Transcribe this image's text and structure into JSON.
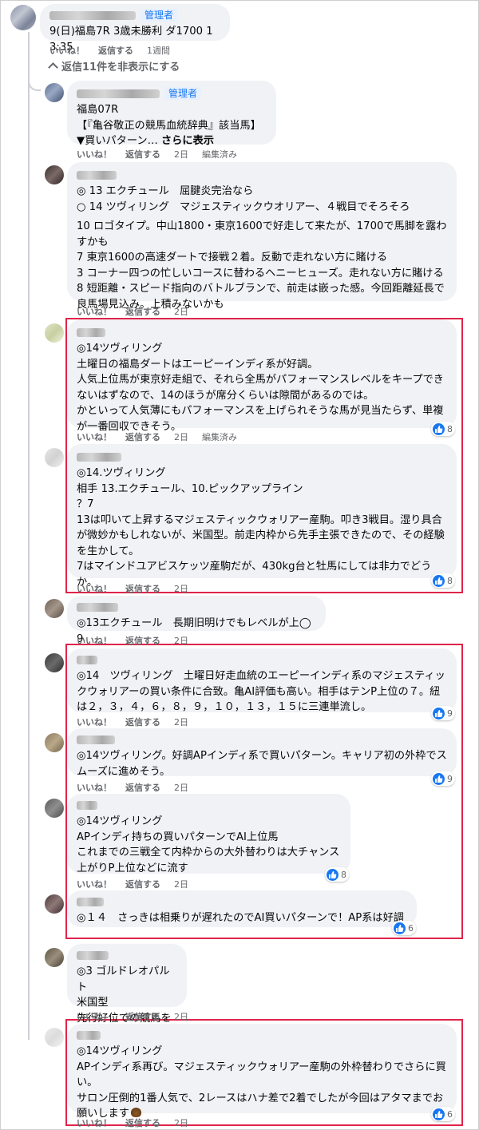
{
  "ui": {
    "admin_label": "管理者",
    "like_label": "いいね！",
    "reply_label": "返信する",
    "edited_label": "編集済み",
    "hide_replies_label": "返信11件を非表示にする"
  },
  "colors": {
    "accent": "#1877f2",
    "highlight_box": "#e0244a",
    "bubble_bg": "#f0f2f5",
    "meta_text": "#65676b"
  },
  "comments": [
    {
      "text": "9(日)福島7R 3歳未勝利 ダ1700 13:35",
      "time": "1週間"
    },
    {
      "text": "福島07R\n【『亀谷敬正の競馬血統辞典』該当馬】\n▼買いパターン… ",
      "see_more": "さらに表示",
      "time": "2日",
      "edited": true
    },
    {
      "text": "◎ 13 エクチュール　屈腱炎完治なら\n○ 14 ツヴィリング　マジェスティックウオリアー、４戦目でそろそろ",
      "text2": "10 ロゴタイプ。中山1800・東京1600で好走して来たが、1700で馬脚を露わすかも\n7 東京1600の高速ダートで接戦２着。反動で走れない方に賭ける\n3 コーナー四つの忙しいコースに替わるヘニーヒューズ。走れない方に賭ける\n8 短距離・スピード指向のバトルブランで、前走は嵌った感。今回距離延長で良馬場見込み。上積みないかも",
      "time": "2日"
    },
    {
      "text": "◎14ツヴィリング\n土曜日の福島ダートはエーピーインディ系が好調。\n人気上位馬が東京好走組で、それら全馬がパフォーマンスレベルをキープできないはずなので、14のほうが席分くらいは隙間があるのでは。\nかといって人気薄にもパフォーマンスを上げられそうな馬が見当たらず、単複が一番回収できそう。",
      "time": "2日",
      "edited": true,
      "likes": "8"
    },
    {
      "text": "◎14.ツヴィリング\n相手 13.エクチュール、10.ピックアップライン\n？7\n13は叩いて上昇するマジェスティックウォリアー産駒。叩き3戦目。湿り具合が微妙かもしれないが、米国型。前走内枠から先手主張できたので、その経験を生かして。\n7はマインドユアビスケッツ産駒だが、430kg台と牡馬にしては非力でどうか。",
      "time": "2日",
      "likes": "8"
    },
    {
      "text": "◎13エクチュール　長期旧明けでもレベルが上◯9",
      "time": "2日"
    },
    {
      "text": "◎14　ツヴィリング　土曜日好走血統のエーピーインディ系のマジェスティックウォリアーの買い条件に合致。亀AI評価も高い。相手はテンP上位の７。紐は２，３，４，６，８，９，１０，１３，１５に三連単流し。",
      "time": "2日",
      "likes": "9"
    },
    {
      "text": "◎14ツヴィリング。好調APインディ系で買いパターン。キャリア初の外枠でスムーズに進めそう。",
      "time": "2日",
      "likes": "9"
    },
    {
      "text": "◎14ツヴィリング\nAPインディ持ちの買いパターンでAI上位馬\nこれまでの三戦全て内枠からの大外替わりは大チャンス\n上がりP上位などに流す",
      "time": "2日",
      "likes": "8"
    },
    {
      "text": "◎１４　さっきは相乗りが遅れたのでAI買いパターンで！AP系は好調",
      "time": "2日",
      "likes": "6"
    },
    {
      "text": "◎3 ゴルドレオパルト\n米国型\n先行好位での競馬を",
      "time": "2日"
    },
    {
      "text": "◎14ツヴィリング\nAPインディ系再び。マジェスティックウォリアー産駒の外枠替わりでさらに買い。\nサロン圧倒的1番人気で、2レースはハナ差で2着でしたが今回はアタマまでお願いします",
      "emoji": "poop-emoji",
      "time": "2日",
      "likes": "6"
    }
  ]
}
